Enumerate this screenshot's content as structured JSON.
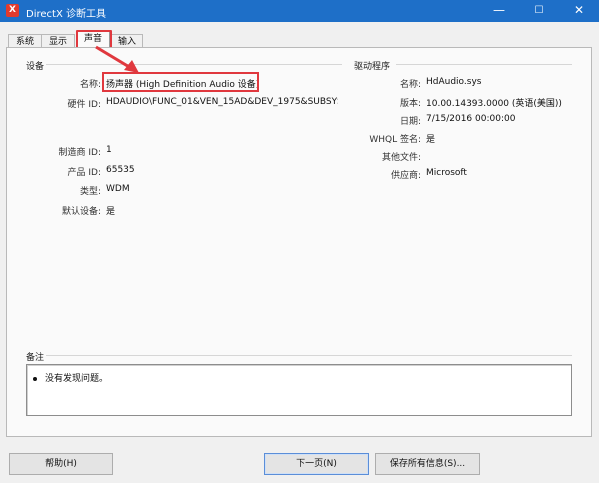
{
  "window": {
    "title": "DirectX 诊断工具",
    "icon_glyph": "X",
    "minimize": "—",
    "maximize": "☐",
    "close": "✕",
    "titlebar_color": "#1e6fc8"
  },
  "tabs": [
    {
      "label": "系统"
    },
    {
      "label": "显示"
    },
    {
      "label": "声音"
    },
    {
      "label": "输入"
    }
  ],
  "active_tab": "声音",
  "device": {
    "group_title": "设备",
    "name_label": "名称:",
    "name_value": "扬声器 (High Definition Audio 设备)",
    "hwid_label": "硬件 ID:",
    "hwid_value": "HDAUDIO\\FUNC_01&VEN_15AD&DEV_1975&SUBSYS_",
    "mfr_label": "制造商 ID:",
    "mfr_value": "1",
    "product_label": "产品 ID:",
    "product_value": "65535",
    "type_label": "类型:",
    "type_value": "WDM",
    "default_label": "默认设备:",
    "default_value": "是"
  },
  "driver": {
    "group_title": "驱动程序",
    "name_label": "名称:",
    "name_value": "HdAudio.sys",
    "version_label": "版本:",
    "version_value": "10.00.14393.0000 (英语(美国))",
    "date_label": "日期:",
    "date_value": "7/15/2016 00:00:00",
    "whql_label": "WHQL 签名:",
    "whql_value": "是",
    "other_files_label": "其他文件:",
    "other_files_value": "",
    "provider_label": "供应商:",
    "provider_value": "Microsoft"
  },
  "notes": {
    "group_title": "备注",
    "items": [
      "没有发现问题。"
    ]
  },
  "buttons": {
    "help": "帮助(H)",
    "next_page": "下一页(N)",
    "save_all": "保存所有信息(S)..."
  },
  "highlight_color": "#e0383e"
}
